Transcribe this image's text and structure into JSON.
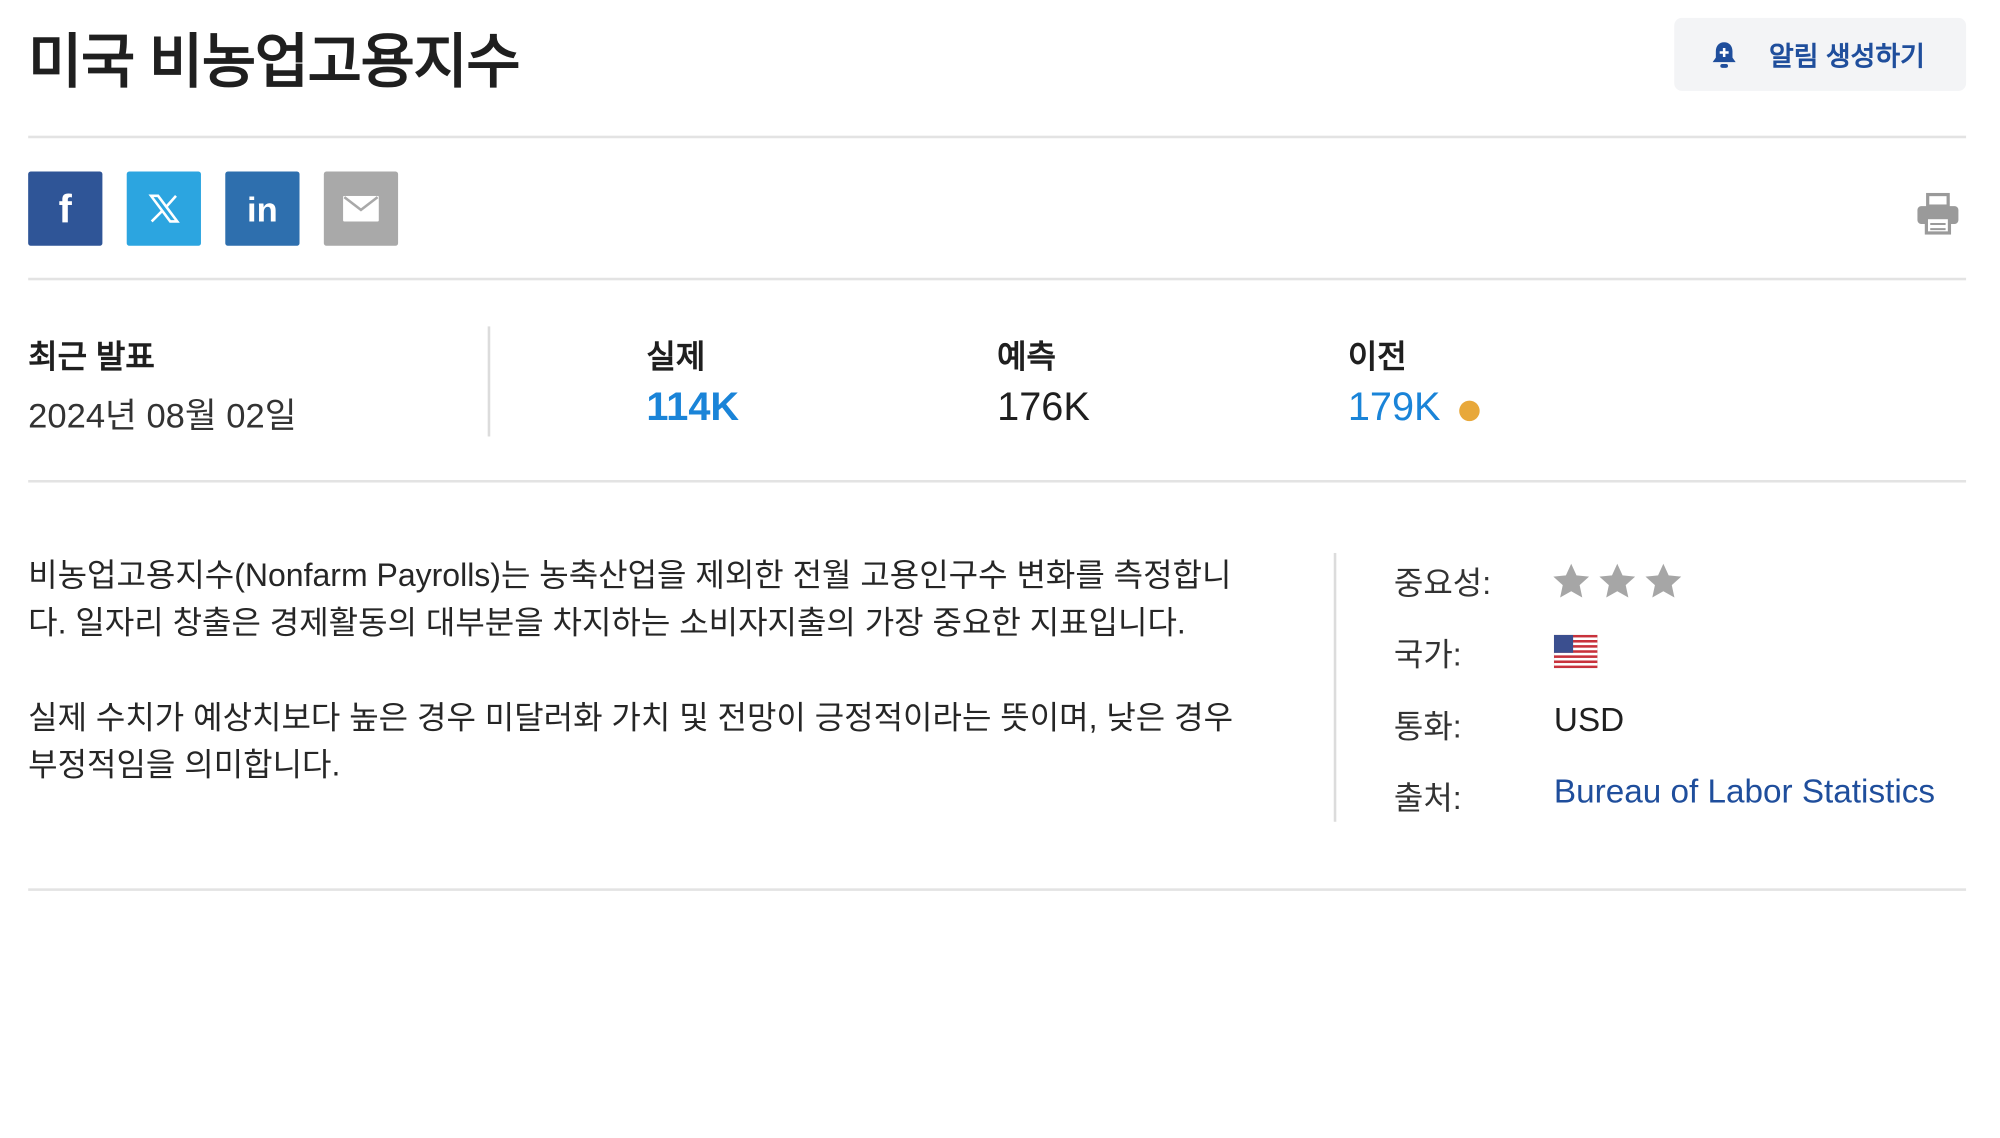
{
  "title": "미국 비농업고용지수",
  "alert_button": {
    "label": "알림 생성하기",
    "icon": "bell-plus-icon"
  },
  "share": [
    {
      "name": "facebook",
      "icon": "facebook-icon",
      "color": "#2f5597"
    },
    {
      "name": "x",
      "icon": "x-icon",
      "color": "#2ca5e0"
    },
    {
      "name": "linkedin",
      "icon": "linkedin-icon",
      "color": "#2e6fae"
    },
    {
      "name": "email",
      "icon": "mail-icon",
      "color": "#a9a9a9"
    }
  ],
  "print_icon": "printer-icon",
  "latest_release": {
    "label": "최근 발표",
    "date": "2024년 08월 02일"
  },
  "actual": {
    "label": "실제",
    "value": "114K",
    "color": "#1a84d8"
  },
  "forecast": {
    "label": "예측",
    "value": "176K"
  },
  "previous": {
    "label": "이전",
    "value": "179K",
    "revision_dot_color": "#e8a83a"
  },
  "description": {
    "p1": "비농업고용지수(Nonfarm Payrolls)는 농축산업을 제외한 전월 고용인구수 변화를 측정합니다. 일자리 창출은 경제활동의 대부분을 차지하는 소비자지출의 가장 중요한 지표입니다.",
    "p2": "실제 수치가 예상치보다 높은 경우 미달러화 가치 및 전망이 긍정적이라는 뜻이며, 낮은 경우 부정적임을 의미합니다."
  },
  "meta": {
    "importance_label": "중요성:",
    "importance_stars": 3,
    "country_label": "국가:",
    "country_flag": "us-flag-icon",
    "currency_label": "통화:",
    "currency": "USD",
    "source_label": "출처:",
    "source": "Bureau of Labor Statistics"
  }
}
